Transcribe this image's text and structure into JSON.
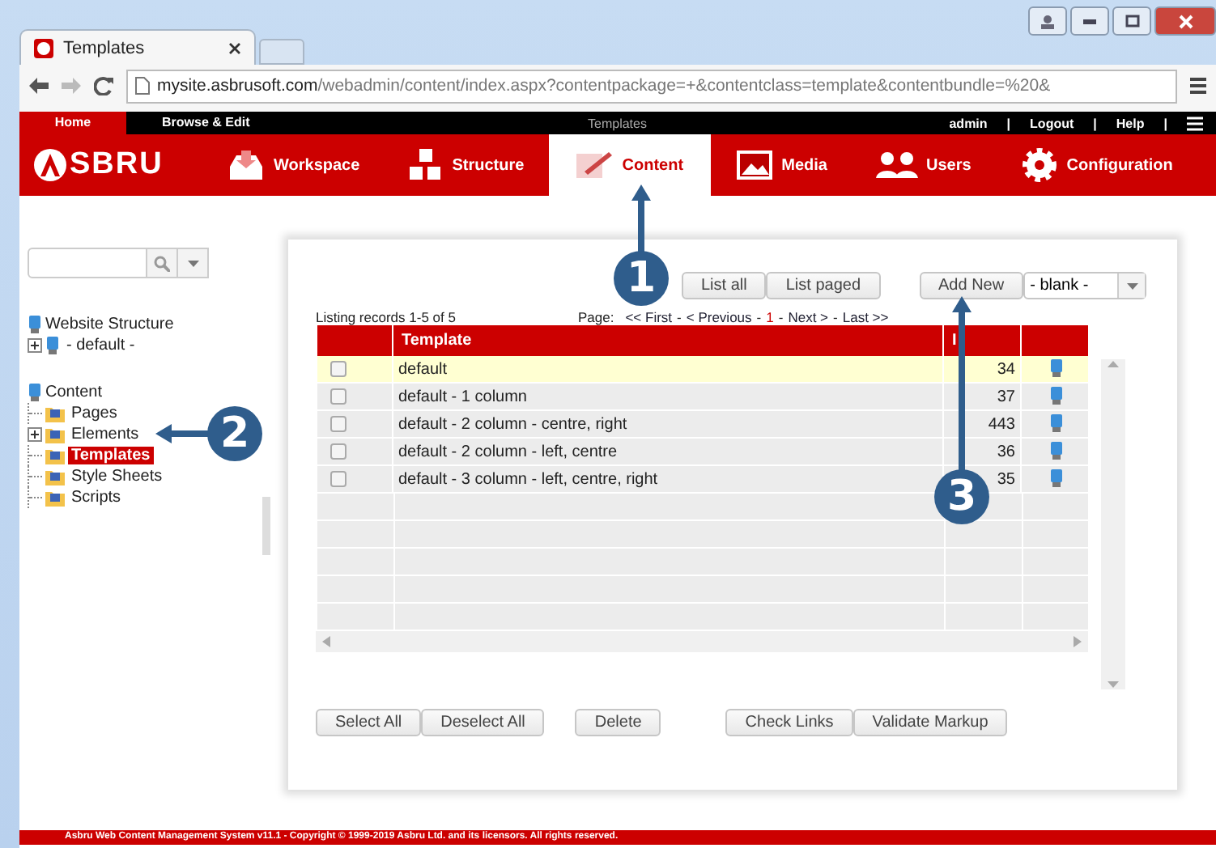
{
  "browser": {
    "tab_title": "Templates",
    "url_host": "mysite.asbrusoft.com",
    "url_path": "/webadmin/content/index.aspx?contentpackage=+&contentclass=template&contentbundle=%20&"
  },
  "topbar": {
    "items": [
      {
        "label": "Home",
        "selected": true
      },
      {
        "label": "Browse & Edit",
        "selected": false
      }
    ],
    "center": "Templates",
    "user": "admin",
    "links": [
      "Logout",
      "Help"
    ],
    "separator": "|"
  },
  "nav": {
    "logo": "SBRU",
    "items": [
      {
        "label": "Workspace",
        "selected": false
      },
      {
        "label": "Structure",
        "selected": false
      },
      {
        "label": "Content",
        "selected": true
      },
      {
        "label": "Media",
        "selected": false
      },
      {
        "label": "Users",
        "selected": false
      },
      {
        "label": "Configuration",
        "selected": false
      }
    ]
  },
  "sidebar": {
    "tree": [
      {
        "label": "Website Structure",
        "children": [
          {
            "label": "- default -",
            "expanded": false,
            "selected": false
          }
        ]
      },
      {
        "label": "Content",
        "children": [
          {
            "label": "Pages",
            "selected": false
          },
          {
            "label": "Elements",
            "expanded": false,
            "selected": false
          },
          {
            "label": "Templates",
            "selected": true
          },
          {
            "label": "Style Sheets",
            "selected": false
          },
          {
            "label": "Scripts",
            "selected": false
          }
        ]
      }
    ]
  },
  "panel": {
    "list_buttons": [
      {
        "label": "List all",
        "selected": false
      },
      {
        "label": "List paged",
        "selected": false
      }
    ],
    "add_button": "Add New",
    "add_select": "- blank -",
    "listing": "Listing records 1-5 of 5",
    "pager": {
      "label": "Page:",
      "separator": "-",
      "links": [
        {
          "label": "<< First",
          "selected": false
        },
        {
          "label": "< Previous",
          "selected": false
        },
        {
          "label": "1",
          "selected": true
        },
        {
          "label": "Next >",
          "selected": false
        },
        {
          "label": "Last >>",
          "selected": false
        }
      ]
    },
    "table": {
      "columns": [
        "Template",
        "I"
      ],
      "rows": [
        {
          "name": "default",
          "id": "34",
          "checked": false,
          "selected": true
        },
        {
          "name": "default - 1 column",
          "id": "37",
          "checked": false,
          "selected": false
        },
        {
          "name": "default - 2 column - centre, right",
          "id": "443",
          "checked": false,
          "selected": false
        },
        {
          "name": "default - 2 column - left, centre",
          "id": "36",
          "checked": false,
          "selected": false
        },
        {
          "name": "default - 3 column - left, centre, right",
          "id": "35",
          "checked": false,
          "selected": false
        }
      ]
    },
    "bottom_buttons": [
      [
        "Select All",
        "Deselect All"
      ],
      [
        "Delete"
      ],
      [
        "Check Links",
        "Validate Markup"
      ]
    ]
  },
  "footer": "Asbru Web Content Management System v11.1 - Copyright © 1999-2019 Asbru Ltd. and its licensors. All rights reserved.",
  "callouts": [
    {
      "label": "1"
    },
    {
      "label": "2"
    },
    {
      "label": "3"
    }
  ]
}
